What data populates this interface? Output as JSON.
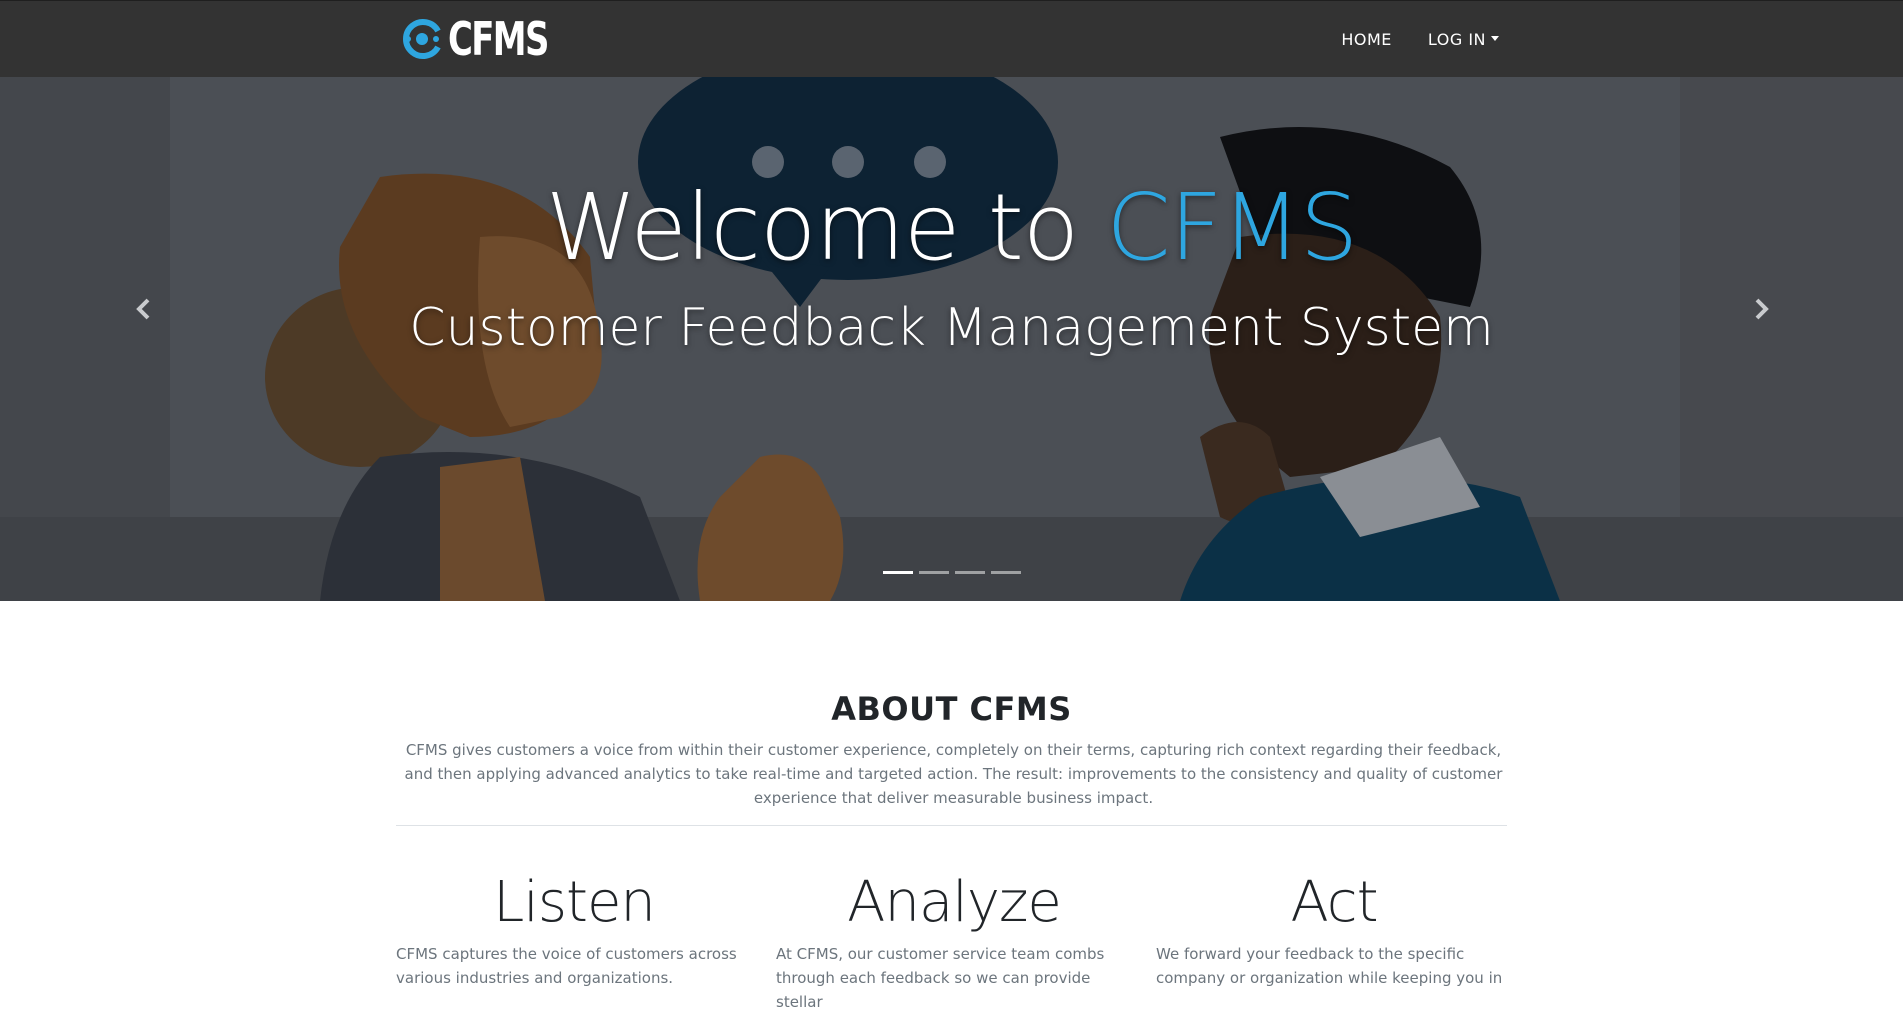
{
  "navbar": {
    "brand_text": "CFMS",
    "links": [
      {
        "label": "HOME"
      },
      {
        "label": "LOG IN"
      }
    ]
  },
  "hero": {
    "title_main": "Welcome to ",
    "title_accent": "CFMS",
    "subtitle": "Customer Feedback Management System",
    "indicator_count": 4,
    "active_indicator": 1
  },
  "about": {
    "title": "ABOUT CFMS",
    "text": "CFMS gives customers a voice from within their customer experience, completely on their terms, capturing rich context regarding their feedback, and then applying advanced analytics to take real-time and targeted action. The result: improvements to the consistency and quality of customer experience that deliver measurable business impact."
  },
  "features": [
    {
      "title": "Listen",
      "text": "CFMS captures the voice of customers across various industries and organizations."
    },
    {
      "title": "Analyze",
      "text": "At CFMS, our customer service team combs through each feedback so we can provide stellar"
    },
    {
      "title": "Act",
      "text": "We forward your feedback to the specific company or organization while keeping you in"
    }
  ],
  "colors": {
    "navbar_bg": "#333333",
    "accent": "#2ea6e0",
    "muted_text": "#6c757d"
  },
  "icons": {
    "prev": "chevron-left-icon",
    "next": "chevron-right-icon",
    "dropdown": "caret-down-icon",
    "logo": "cfms-logo-icon"
  }
}
